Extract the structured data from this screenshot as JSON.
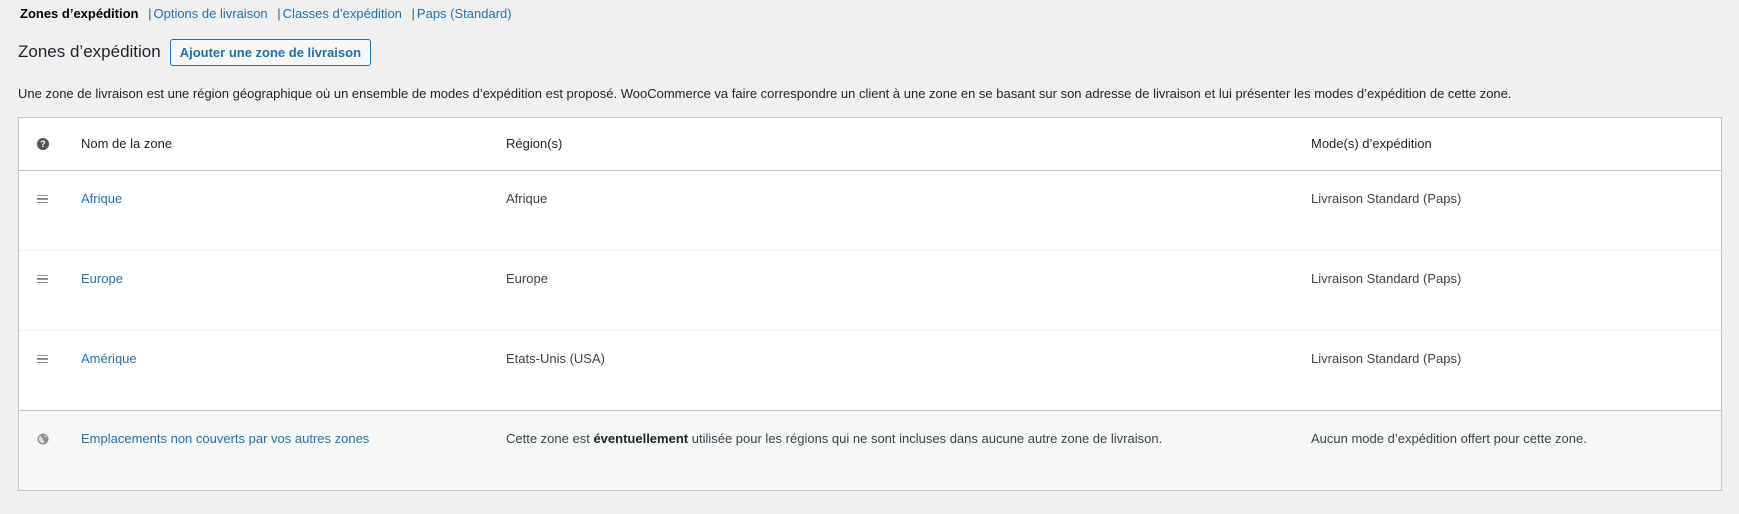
{
  "subnav": {
    "current": "Zones d’expédition",
    "links": [
      {
        "label": "Options de livraison"
      },
      {
        "label": "Classes d’expédition"
      },
      {
        "label": "Paps (Standard)"
      }
    ],
    "separator": "|"
  },
  "header": {
    "title": "Zones d’expédition",
    "add_button": "Ajouter une zone de livraison"
  },
  "description": "Une zone de livraison est une région géographique où un ensemble de modes d’expédition est proposé. WooCommerce va faire correspondre un client à une zone en se basant sur son adresse de livraison et lui présenter les modes d’expédition de cette zone.",
  "table": {
    "columns": {
      "help_icon": "help-icon",
      "name": "Nom de la zone",
      "regions": "Région(s)",
      "methods": "Mode(s) d’expédition"
    },
    "zones": [
      {
        "name": "Afrique",
        "regions": "Afrique",
        "methods": "Livraison Standard (Paps)"
      },
      {
        "name": "Europe",
        "regions": "Europe",
        "methods": "Livraison Standard (Paps)"
      },
      {
        "name": "Amérique",
        "regions": "Etats-Unis (USA)",
        "methods": "Livraison Standard (Paps)"
      }
    ],
    "rest_of_world": {
      "name": "Emplacements non couverts par vos autres zones",
      "regions_prefix": "Cette zone est ",
      "regions_emphasis": "éventuellement",
      "regions_suffix": " utilisée pour les régions qui ne sont incluses dans aucune autre zone de livraison.",
      "methods": "Aucun mode d’expédition offert pour cette zone."
    }
  },
  "colors": {
    "link": "#2271b1",
    "background": "#f0f0f1",
    "border": "#c3c4c7"
  }
}
